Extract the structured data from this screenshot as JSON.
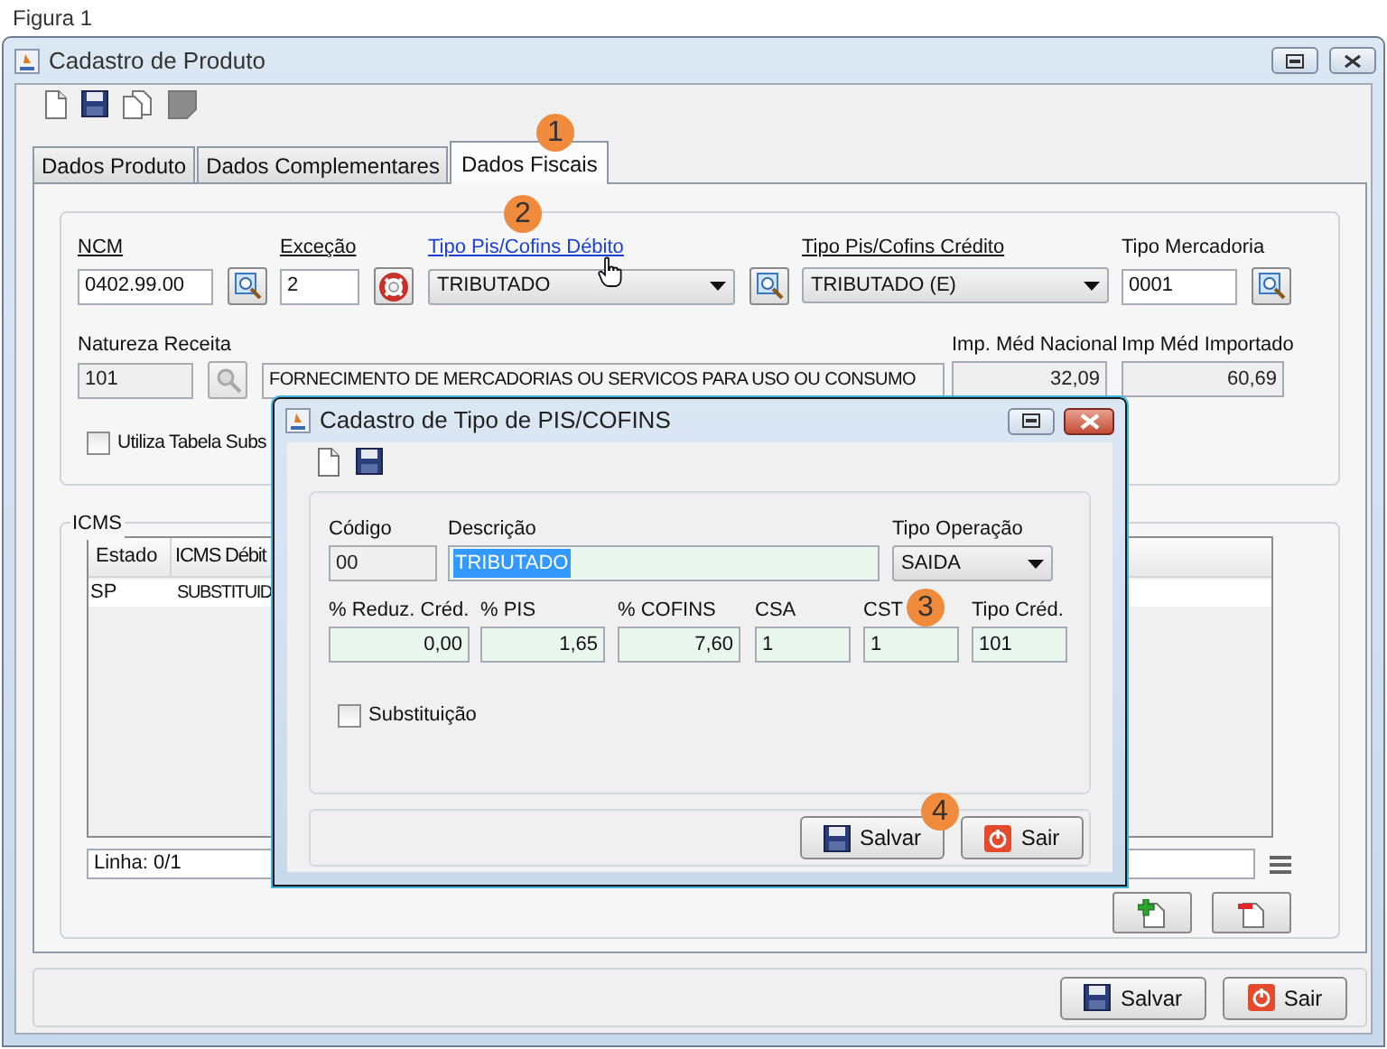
{
  "caption": "Figura 1",
  "window": {
    "title": "Cadastro de Produto"
  },
  "tabs": [
    {
      "label": "Dados Produto",
      "selected": false
    },
    {
      "label": "Dados Complementares",
      "selected": false
    },
    {
      "label": "Dados Fiscais",
      "selected": true
    }
  ],
  "fiscal": {
    "row1": [
      {
        "label": "NCM",
        "underlined": true,
        "link": false,
        "kind": "input",
        "value": "0402.99.00",
        "buttons": [
          {
            "kind": "search"
          }
        ]
      },
      {
        "label": "Exceção",
        "underlined": true,
        "link": false,
        "kind": "input",
        "value": "2",
        "buttons": [
          {
            "kind": "lifebuoy"
          }
        ]
      },
      {
        "label": "Tipo Pis/Cofins Débito",
        "underlined": true,
        "link": true,
        "kind": "combo",
        "value": "TRIBUTADO",
        "buttons": [
          {
            "kind": "search"
          }
        ]
      },
      {
        "label": "Tipo Pis/Cofins Crédito",
        "underlined": true,
        "link": false,
        "kind": "combo",
        "value": "TRIBUTADO (E)"
      },
      {
        "label": "Tipo Mercadoria",
        "underlined": false,
        "link": false,
        "kind": "input",
        "value": "0001",
        "buttons": [
          {
            "kind": "search"
          }
        ]
      }
    ],
    "natureza_receita": {
      "label": "Natureza Receita",
      "code": "101",
      "description": "FORNECIMENTO DE MERCADORIAS OU SERVICOS PARA USO OU CONSUMO"
    },
    "imp_med_nacional": {
      "label": "Imp. Méd Nacional",
      "value": "32,09"
    },
    "imp_med_importado": {
      "label": "Imp Méd Importado",
      "value": "60,69"
    },
    "utiliza_tabela": {
      "label": "Utiliza Tabela Subs",
      "checked": false
    }
  },
  "icms": {
    "title": "ICMS",
    "columns": [
      "Estado",
      "ICMS Débit"
    ],
    "rows": [
      [
        "SP",
        "SUBSTITUID"
      ]
    ],
    "status": "Linha: 0/1"
  },
  "buttons": [
    "Salvar",
    "Sair"
  ],
  "dialog": {
    "title": "Cadastro de Tipo de PIS/COFINS",
    "codigo": {
      "label": "Código",
      "value": "00"
    },
    "descricao": {
      "label": "Descrição",
      "value": "TRIBUTADO",
      "selected": true
    },
    "tipo_operacao": {
      "label": "Tipo Operação",
      "value": "SAIDA"
    },
    "fields": [
      {
        "label": "% Reduz. Créd.",
        "value": "0,00",
        "kind": "number"
      },
      {
        "label": "% PIS",
        "value": "1,65",
        "kind": "number"
      },
      {
        "label": "% COFINS",
        "value": "7,60",
        "kind": "number"
      },
      {
        "label": "CSA",
        "value": "1",
        "kind": "code"
      },
      {
        "label": "CST",
        "value": "1",
        "kind": "code"
      },
      {
        "label": "Tipo Créd.",
        "value": "101",
        "kind": "code"
      }
    ],
    "substituicao": {
      "label": "Substituição",
      "checked": false
    },
    "buttons": [
      "Salvar",
      "Sair"
    ]
  },
  "callouts": [
    "1",
    "2",
    "3",
    "4"
  ]
}
